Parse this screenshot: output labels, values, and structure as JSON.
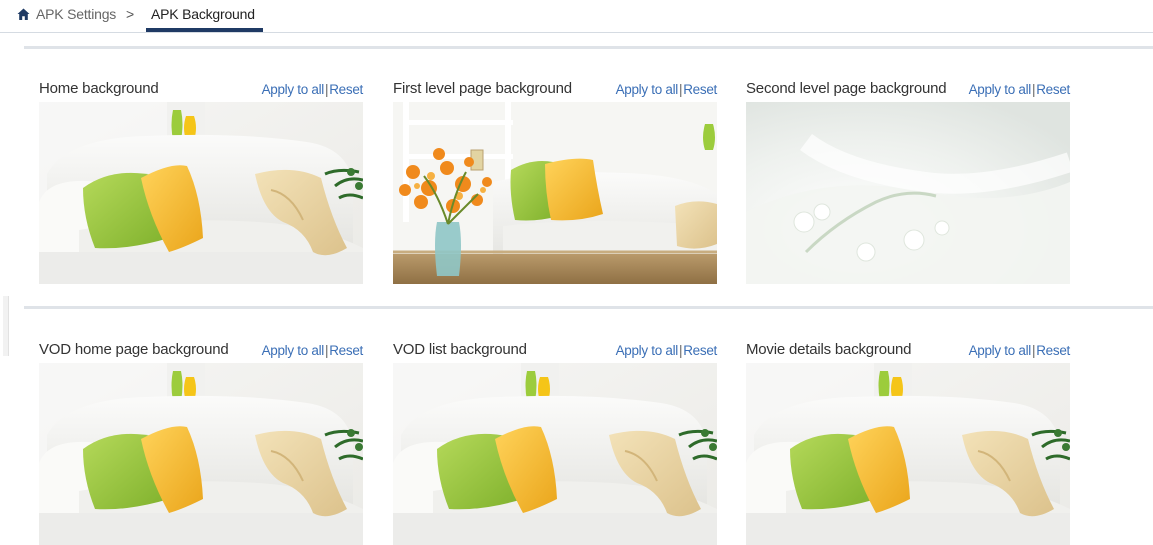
{
  "breadcrumb": {
    "items": [
      "APK Settings",
      "APK Background"
    ],
    "separator": ">",
    "home_icon": "home-icon"
  },
  "accent_color": "#1f3a64",
  "link_color": "#3b6fb6",
  "cards": [
    {
      "title": "Home background",
      "apply_label": "Apply to all",
      "separator": "|",
      "reset_label": "Reset",
      "image": "sofa-green-yellow-pillows"
    },
    {
      "title": "First level page background",
      "apply_label": "Apply to all",
      "separator": "|",
      "reset_label": "Reset",
      "image": "sofa-with-orange-flowers"
    },
    {
      "title": "Second level page background",
      "apply_label": "Apply to all",
      "separator": "|",
      "reset_label": "Reset",
      "image": "white-flower-soft-light"
    },
    {
      "title": "VOD home page background",
      "apply_label": "Apply to all",
      "separator": "|",
      "reset_label": "Reset",
      "image": "sofa-green-yellow-pillows"
    },
    {
      "title": "VOD list background",
      "apply_label": "Apply to all",
      "separator": "|",
      "reset_label": "Reset",
      "image": "sofa-green-yellow-pillows"
    },
    {
      "title": "Movie details background",
      "apply_label": "Apply to all",
      "separator": "|",
      "reset_label": "Reset",
      "image": "sofa-green-yellow-pillows"
    }
  ]
}
